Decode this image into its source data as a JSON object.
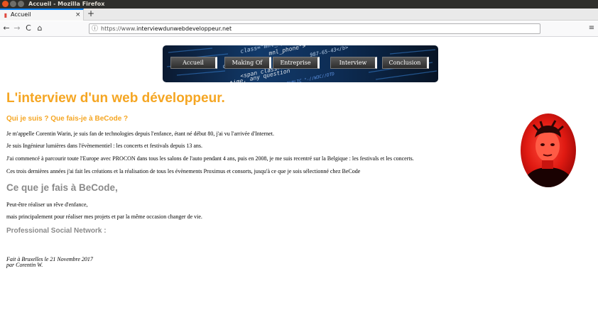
{
  "window": {
    "title": "Accueil - Mozilla Firefox"
  },
  "browser": {
    "tab": {
      "label": "Accueil",
      "close": "×"
    },
    "new_tab": "+",
    "nav": {
      "back": "←",
      "forward": "→",
      "reload": "C",
      "home": "⌂",
      "menu": "≡"
    },
    "url": {
      "scheme": "https://www.",
      "host": "interviewdunwebdeveloppeur.net"
    }
  },
  "banner": {
    "menu": [
      "Accueil",
      "Making Of",
      "Entreprise",
      "Interview",
      "Conclusion"
    ],
    "code_lines": [
      "class=\"mnl_sp\"",
      "mnl_phone\">",
      "987-65-43</b>",
      "ons",
      "<span class=\"bigt",
      "time, any question",
      "PUBLIC \"-//W3C//DTD"
    ]
  },
  "page": {
    "title": "L'interview d'un web développeur.",
    "section1": {
      "heading": "Qui je suis ? Que fais-je à BeCode ?",
      "paragraphs": [
        "Je m'appelle Corentin Warin, je suis fan de technologies depuis l'enfance, étant né début 80, j'ai vu l'arrivée d'Internet.",
        "Je suis Ingénieur lumières dans l'évènementiel : les concerts et festivals depuis 13 ans.",
        "J'ai commencé à parcourir toute l'Europe avec PROCON dans tous les salons de l'auto pendant 4 ans, puis en 2008, je me suis recentré sur la Belgique : les festivals et les concerts.",
        "Ces trois dernières années j'ai fait les créations et la réalisation de tous les évènements Proximus et consorts, jusqu'à ce que je sois sélectionné chez BeCode"
      ]
    },
    "section2": {
      "heading": "Ce que je fais à BeCode,",
      "paragraphs": [
        "Peut-être réaliser un rêve d'enfance,",
        "mais principalement pour réaliser mes projets et par la même occasion changer de vie."
      ]
    },
    "social_heading": "Professional Social Network :",
    "footer": [
      "Fait à Bruxelles le 21 Novembre 2017",
      "par Corentin W."
    ]
  }
}
